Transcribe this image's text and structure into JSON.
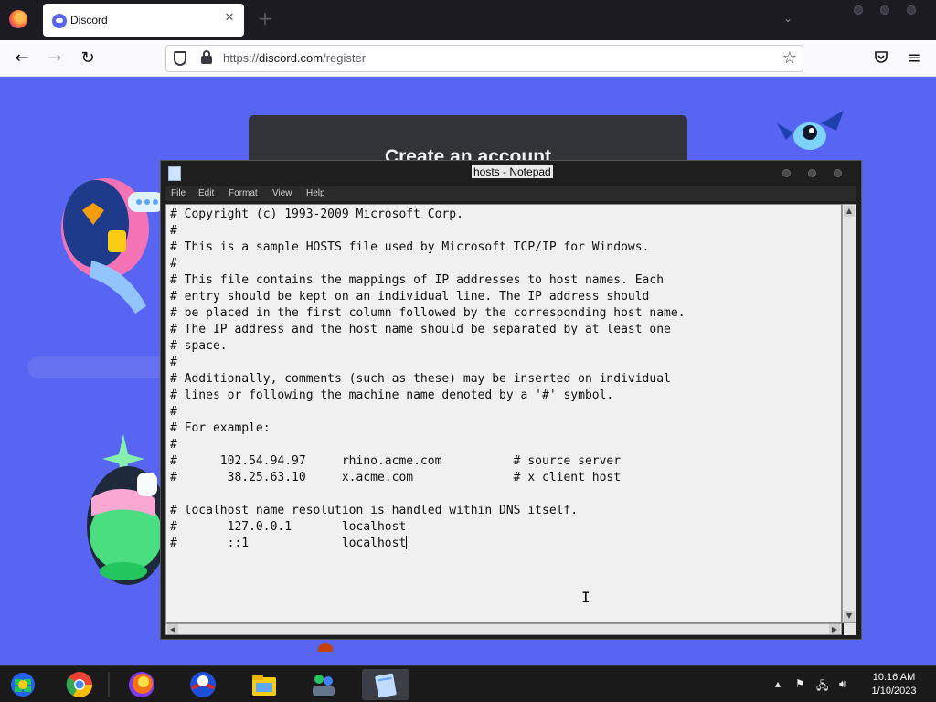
{
  "browser": {
    "tab_title": "Discord",
    "tab_close_glyph": "✕",
    "new_tab_glyph": "+",
    "url_domain": "discord.com",
    "url_prefix": "https://",
    "url_path": "/register"
  },
  "discord": {
    "card_title": "Create an account"
  },
  "notepad": {
    "title": "hosts - Notepad",
    "menu": [
      "File",
      "Edit",
      "Format",
      "View",
      "Help"
    ],
    "lines": [
      "# Copyright (c) 1993-2009 Microsoft Corp.",
      "#",
      "# This is a sample HOSTS file used by Microsoft TCP/IP for Windows.",
      "#",
      "# This file contains the mappings of IP addresses to host names. Each",
      "# entry should be kept on an individual line. The IP address should",
      "# be placed in the first column followed by the corresponding host name.",
      "# The IP address and the host name should be separated by at least one",
      "# space.",
      "#",
      "# Additionally, comments (such as these) may be inserted on individual",
      "# lines or following the machine name denoted by a '#' symbol.",
      "#",
      "# For example:",
      "#",
      "#      102.54.94.97     rhino.acme.com          # source server",
      "#       38.25.63.10     x.acme.com              # x client host",
      "",
      "# localhost name resolution is handled within DNS itself.",
      "#       127.0.0.1       localhost",
      "#       ::1             localhost"
    ]
  },
  "taskbar": {
    "time": "10:16 AM",
    "date": "1/10/2023"
  },
  "colors": {
    "discord_blurple": "#5865f2",
    "card_bg": "#313338"
  }
}
